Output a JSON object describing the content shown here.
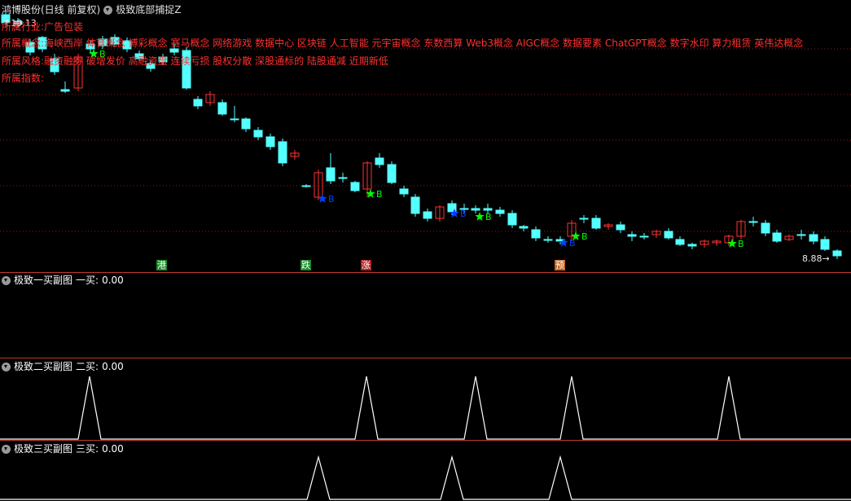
{
  "main_chart": {
    "stock_name": "鸿博股份(日线 前复权)",
    "indicator": "极致底部捕捉Z",
    "high_price": "19.13",
    "info_lines": [
      "所属行业:广告包装",
      "所属概念:海峡西岸 体育概念 博彩概念 赛马概念 网络游戏 数据中心 区块链 人工智能 元宇宙概念 东数西算 Web3概念 AIGC概念 数据要素 ChatGPT概念 数字水印 算力租赁 英伟达概念",
      "所属风格:融资融券 破增发价 高融资盘 连续亏损 股权分散 深股通标的 陆股通减 近期新低",
      "所属指数:"
    ],
    "low_price": "8.88",
    "buy_markers": [
      "B",
      "B",
      "B",
      "B",
      "B",
      "B",
      "B",
      "B"
    ],
    "event_badges": [
      {
        "label": "港",
        "color": "#1a8a2a"
      },
      {
        "label": "跌",
        "color": "#1a8a2a"
      },
      {
        "label": "涨",
        "color": "#b02020"
      },
      {
        "label": "预",
        "color": "#c8641e"
      }
    ],
    "colors": {
      "up": "#ff3232",
      "down": "#54ffff",
      "grid": "#8b1a1a",
      "star_green": "#00ff00",
      "star_blue": "#0040ff"
    }
  },
  "sub_panels": [
    {
      "name": "极致一买副图",
      "label": "一买:",
      "value": "0.00"
    },
    {
      "name": "极致二买副图",
      "label": "二买:",
      "value": "0.00"
    },
    {
      "name": "极致三买副图",
      "label": "三买:",
      "value": "0.00"
    }
  ]
}
